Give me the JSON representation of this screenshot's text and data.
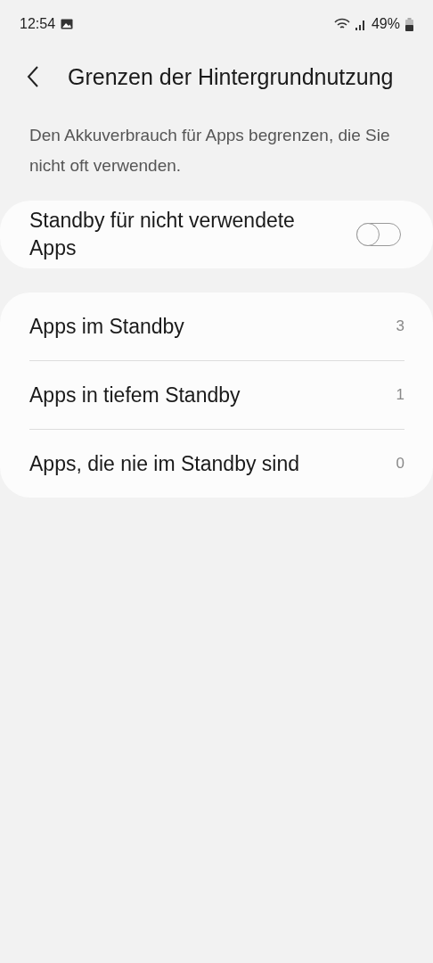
{
  "status_bar": {
    "time": "12:54",
    "battery": "49%"
  },
  "header": {
    "title": "Grenzen der Hintergrundnutzung"
  },
  "description": "Den Akkuverbrauch für Apps begrenzen, die Sie nicht oft verwenden.",
  "toggle": {
    "label": "Standby für nicht verwendete Apps",
    "on": false
  },
  "items": [
    {
      "label": "Apps im Standby",
      "count": "3"
    },
    {
      "label": "Apps in tiefem Standby",
      "count": "1"
    },
    {
      "label": "Apps, die nie im Standby sind",
      "count": "0"
    }
  ]
}
